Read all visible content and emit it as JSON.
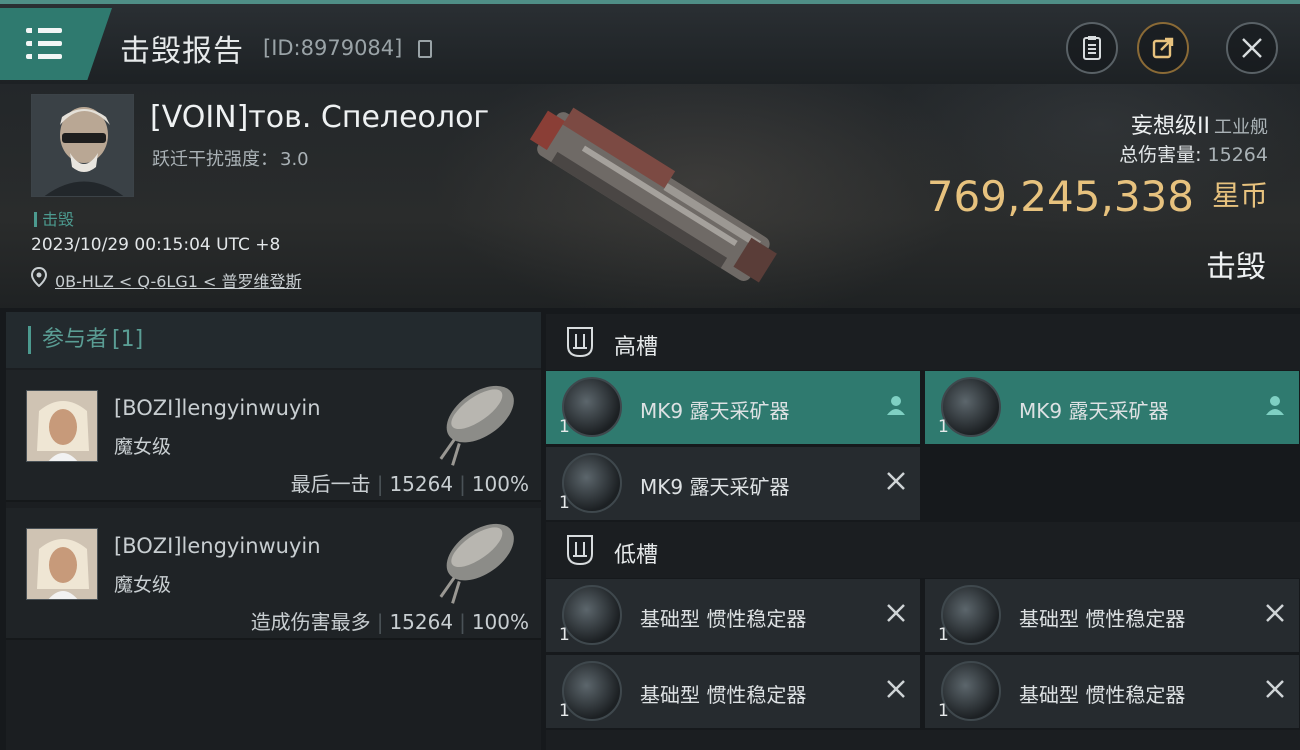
{
  "header": {
    "title": "击毁报告",
    "report_id": "[ID:8979084]",
    "icons": [
      "menu-icon",
      "copy-icon",
      "clipboard-icon",
      "share-icon",
      "close-icon"
    ]
  },
  "victim": {
    "name": "[VOIN]тов. Спелеолог",
    "warp_label": "跃迁干扰强度：",
    "warp_value": "3.0",
    "tag": "击毁",
    "datetime": "2023/10/29 00:15:04 UTC +8",
    "location": "0B-HLZ < Q-6LG1 < 普罗维登斯",
    "ship_name": "妄想级II",
    "ship_class": "工业舰",
    "damage_label": "总伤害量:",
    "damage_value": "15264",
    "isk_value": "769,245,338",
    "isk_unit": "星币",
    "status": "击毁"
  },
  "participants": {
    "title": "参与者",
    "count": "[1]",
    "items": [
      {
        "name": "[BOZI]lengyinwuyin",
        "ship": "魔女级",
        "role": "最后一击",
        "damage": "15264",
        "percent": "100%"
      },
      {
        "name": "[BOZI]lengyinwuyin",
        "ship": "魔女级",
        "role": "造成伤害最多",
        "damage": "15264",
        "percent": "100%"
      }
    ]
  },
  "fitting": {
    "high_slot_label": "高槽",
    "low_slot_label": "低槽",
    "high_modules": [
      {
        "qty": "1",
        "name": "MK9 露天采矿器",
        "status": "pilot-icon"
      },
      {
        "qty": "1",
        "name": "MK9 露天采矿器",
        "status": "pilot-icon"
      },
      {
        "qty": "1",
        "name": "MK9 露天采矿器",
        "status": "destroyed-x-icon"
      }
    ],
    "low_modules": [
      {
        "qty": "1",
        "name": "基础型 惯性稳定器",
        "status": "destroyed-x-icon"
      },
      {
        "qty": "1",
        "name": "基础型 惯性稳定器",
        "status": "destroyed-x-icon"
      },
      {
        "qty": "1",
        "name": "基础型 惯性稳定器",
        "status": "destroyed-x-icon"
      },
      {
        "qty": "1",
        "name": "基础型 惯性稳定器",
        "status": "destroyed-x-icon"
      }
    ]
  },
  "colors": {
    "accent": "#2f7a6f",
    "isk": "#e7c27e",
    "teal_text": "#4c9a8f"
  }
}
